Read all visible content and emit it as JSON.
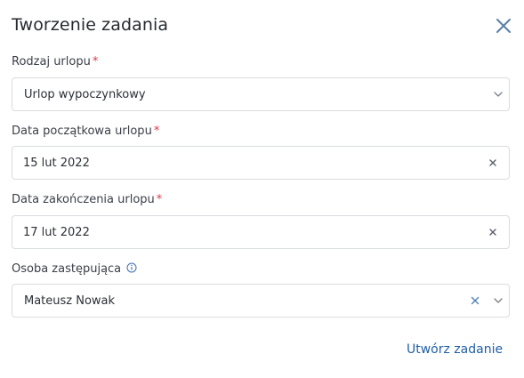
{
  "dialog": {
    "title": "Tworzenie zadania"
  },
  "fields": {
    "leave_type": {
      "label": "Rodzaj urlopu",
      "required_mark": "*",
      "value": "Urlop wypoczynkowy"
    },
    "start_date": {
      "label": "Data początkowa urlopu",
      "required_mark": "*",
      "value": "15 lut 2022"
    },
    "end_date": {
      "label": "Data zakończenia urlopu",
      "required_mark": "*",
      "value": "17 lut 2022"
    },
    "substitute": {
      "label": "Osoba zastępująca",
      "value": "Mateusz Nowak"
    }
  },
  "actions": {
    "submit_label": "Utwórz zadanie"
  },
  "colors": {
    "accent": "#1f5fa8",
    "required": "#e0364a",
    "close_icon": "#5b7fa6",
    "border": "#d9dce1"
  }
}
